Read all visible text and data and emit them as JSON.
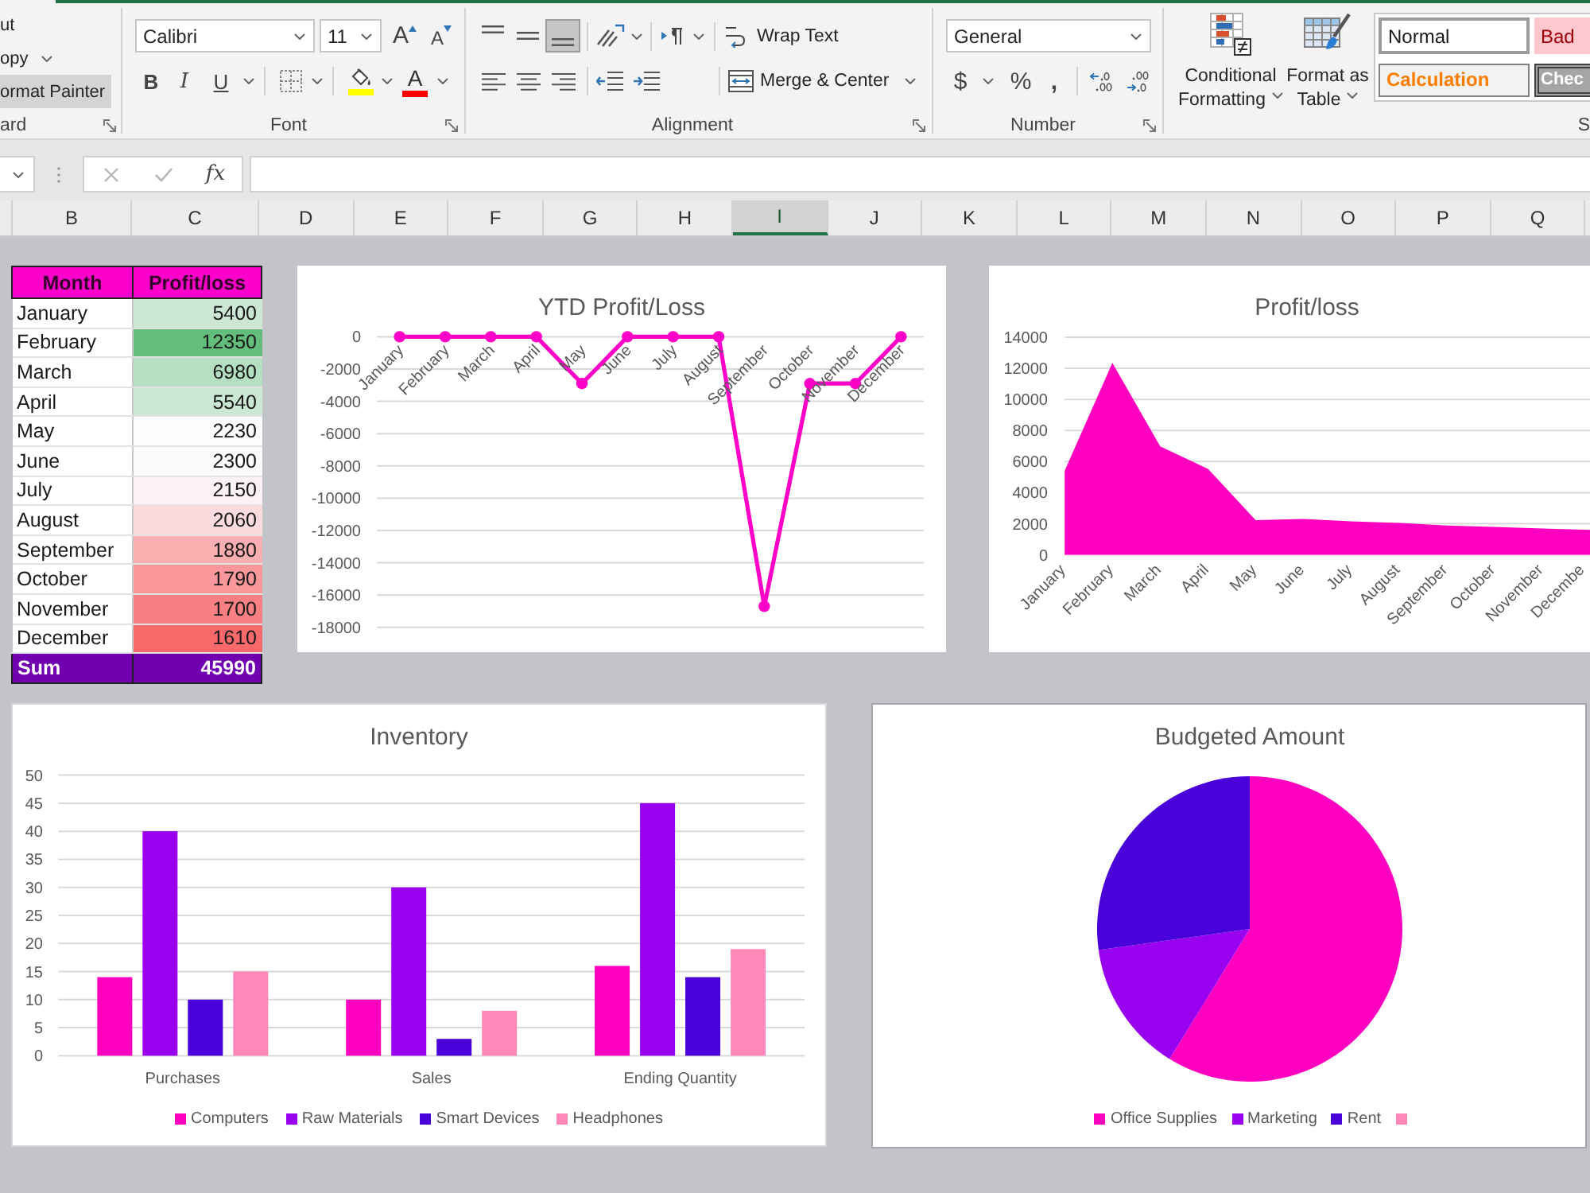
{
  "ribbon": {
    "clipboard": {
      "commands": [
        {
          "kind": "cut",
          "label": "ut",
          "hovered": false
        },
        {
          "kind": "copy",
          "label": "opy",
          "hovered": false
        },
        {
          "kind": "format-painter",
          "label": "ormat Painter",
          "hovered": true
        }
      ],
      "label": "ard"
    },
    "font": {
      "font_name": "Calibri",
      "font_size": "11",
      "size_buttons": [
        {
          "kind": "grow",
          "glyph": "A"
        },
        {
          "kind": "shrink",
          "glyph": "A"
        }
      ],
      "style_buttons": [
        {
          "kind": "bold",
          "glyph": "B"
        },
        {
          "kind": "italic",
          "glyph": "I"
        },
        {
          "kind": "underline",
          "glyph": "U"
        }
      ],
      "fill_color": {
        "color": "#ffff00"
      },
      "font_color": {
        "glyph": "A",
        "color": "#ff0000"
      },
      "label": "Font"
    },
    "alignment": {
      "vertical": [
        {
          "kind": "top",
          "selected": false
        },
        {
          "kind": "middle",
          "selected": false
        },
        {
          "kind": "bottom",
          "selected": true
        }
      ],
      "horizontal": [
        {
          "kind": "left",
          "selected": false
        },
        {
          "kind": "center",
          "selected": false
        },
        {
          "kind": "right",
          "selected": false
        }
      ],
      "wrap_text": "Wrap Text",
      "merge": "Merge & Center",
      "label": "Alignment"
    },
    "number": {
      "format": "General",
      "buttons": [
        {
          "kind": "currency",
          "glyph": "$"
        },
        {
          "kind": "percent",
          "glyph": "%"
        },
        {
          "kind": "comma",
          "glyph": ","
        }
      ],
      "label": "Number"
    },
    "styles": {
      "conditional_formatting": [
        "Conditional",
        "Formatting"
      ],
      "format_as_table": [
        "Format as",
        "Table"
      ],
      "cell_styles": [
        {
          "kind": "normal",
          "label": "Normal"
        },
        {
          "kind": "bad",
          "label": "Bad"
        },
        {
          "kind": "calculation",
          "label": "Calculation"
        },
        {
          "kind": "check",
          "label": "Chec"
        }
      ],
      "label": "S"
    }
  },
  "formula_bar": {
    "buttons": [
      {
        "kind": "cancel",
        "disabled": true
      },
      {
        "kind": "enter",
        "disabled": true
      },
      {
        "kind": "function",
        "label": "fx",
        "disabled": false
      }
    ]
  },
  "column_headers": [
    {
      "label": "B",
      "selected": false
    },
    {
      "label": "C",
      "selected": false
    },
    {
      "label": "D",
      "selected": false
    },
    {
      "label": "E",
      "selected": false
    },
    {
      "label": "F",
      "selected": false
    },
    {
      "label": "G",
      "selected": false
    },
    {
      "label": "H",
      "selected": false
    },
    {
      "label": "I",
      "selected": true
    },
    {
      "label": "J",
      "selected": false
    },
    {
      "label": "K",
      "selected": false
    },
    {
      "label": "L",
      "selected": false
    },
    {
      "label": "M",
      "selected": false
    },
    {
      "label": "N",
      "selected": false
    },
    {
      "label": "O",
      "selected": false
    },
    {
      "label": "P",
      "selected": false
    },
    {
      "label": "Q",
      "selected": false
    }
  ],
  "table": {
    "columns": [
      "Month",
      "Profit/loss"
    ],
    "rows": [
      {
        "month": "January",
        "value": "5400",
        "color": "#cce8d5"
      },
      {
        "month": "February",
        "value": "12350",
        "color": "#63be7b"
      },
      {
        "month": "March",
        "value": "6980",
        "color": "#b4dfc1"
      },
      {
        "month": "April",
        "value": "5540",
        "color": "#cae8d3"
      },
      {
        "month": "May",
        "value": "2230",
        "color": "#fbfcfe"
      },
      {
        "month": "June",
        "value": "2300",
        "color": "#fafbfd"
      },
      {
        "month": "July",
        "value": "2150",
        "color": "#fcf2f5"
      },
      {
        "month": "August",
        "value": "2060",
        "color": "#fbdbde"
      },
      {
        "month": "September",
        "value": "1880",
        "color": "#faaeb0"
      },
      {
        "month": "October",
        "value": "1790",
        "color": "#f9979a"
      },
      {
        "month": "November",
        "value": "1700",
        "color": "#f98082"
      },
      {
        "month": "December",
        "value": "1610",
        "color": "#f8696b"
      }
    ],
    "total": {
      "label": "Sum",
      "value": "45990"
    }
  },
  "ytd_chart": {
    "chart_data": {
      "type": "line",
      "title": "YTD Profit/Loss",
      "categories": [
        "January",
        "February",
        "March",
        "April",
        "May",
        "June",
        "July",
        "August",
        "September",
        "October",
        "November",
        "December"
      ],
      "series": [
        {
          "color": "#ff00c8",
          "marker": true,
          "values": [
            0,
            0,
            0,
            0,
            -2900,
            0,
            0,
            0,
            -16700,
            -2900,
            -2900,
            0
          ]
        }
      ],
      "ylim": [
        -18000,
        0
      ],
      "yticks": [
        -18000,
        -16000,
        -14000,
        -12000,
        -10000,
        -8000,
        -6000,
        -4000,
        -2000,
        0
      ],
      "grid": true
    }
  },
  "profit_chart": {
    "chart_data": {
      "type": "area",
      "title": "Profit/loss",
      "categories": [
        "January",
        "February",
        "March",
        "April",
        "May",
        "June",
        "July",
        "August",
        "September",
        "October",
        "November",
        "Decembe"
      ],
      "series": [
        {
          "color": "#ff00c0",
          "values": [
            5400,
            12350,
            6980,
            5540,
            2230,
            2300,
            2150,
            2060,
            1880,
            1790,
            1700,
            1610
          ]
        }
      ],
      "ylim": [
        0,
        14000
      ],
      "yticks": [
        0,
        2000,
        4000,
        6000,
        8000,
        10000,
        12000,
        14000
      ],
      "grid": true
    }
  },
  "inventory_chart": {
    "chart_data": {
      "type": "bar",
      "title": "Inventory",
      "categories": [
        "Purchases",
        "Sales",
        "Ending Quantity"
      ],
      "series": [
        {
          "name": "Computers",
          "color": "#ff00c0",
          "values": [
            14,
            10,
            16
          ]
        },
        {
          "name": "Raw Materials",
          "color": "#9900f0",
          "values": [
            40,
            30,
            45
          ]
        },
        {
          "name": "Smart Devices",
          "color": "#4a00d8",
          "values": [
            10,
            3,
            14
          ]
        },
        {
          "name": "Headphones",
          "color": "#ff88b8",
          "values": [
            15,
            8,
            19
          ]
        }
      ],
      "ylim": [
        0,
        50
      ],
      "yticks": [
        0,
        5,
        10,
        15,
        20,
        25,
        30,
        35,
        40,
        45,
        50
      ],
      "grid": true,
      "legend": "bottom"
    }
  },
  "budget_chart": {
    "title": "Budgeted Amount",
    "legend": [
      {
        "label": "Office Supplies",
        "color": "#ff00c0"
      },
      {
        "label": "Marketing",
        "color": "#9900f0"
      },
      {
        "label": "Rent",
        "color": "#4a00d8"
      },
      {
        "color": "#ff88b8"
      }
    ]
  }
}
